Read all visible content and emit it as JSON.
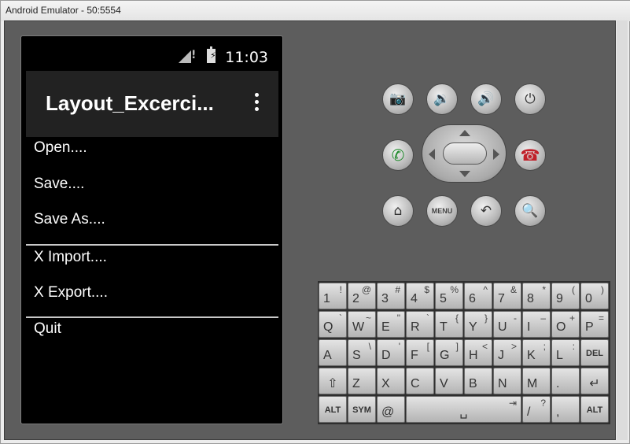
{
  "window": {
    "title": "Android Emulator - 50:5554"
  },
  "status_bar": {
    "time": "11:03"
  },
  "action_bar": {
    "title": "Layout_Excerci..."
  },
  "menu": {
    "items": [
      "Open....",
      "Save....",
      "Save As....",
      "X Import....",
      "X Export....",
      "Quit"
    ]
  },
  "controls": {
    "row1": [
      "camera-icon",
      "volume-down-icon",
      "volume-up-icon",
      "power-icon"
    ],
    "call": "call-icon",
    "end_call": "end-call-icon",
    "row3": [
      "home-icon",
      "menu-button",
      "back-icon",
      "search-icon"
    ],
    "menu_label": "MENU"
  },
  "keyboard": {
    "row1": [
      [
        "1",
        "!"
      ],
      [
        "2",
        "@"
      ],
      [
        "3",
        "#"
      ],
      [
        "4",
        "$"
      ],
      [
        "5",
        "%"
      ],
      [
        "6",
        "^"
      ],
      [
        "7",
        "&"
      ],
      [
        "8",
        "*"
      ],
      [
        "9",
        "("
      ],
      [
        "0",
        ")"
      ]
    ],
    "row2": [
      [
        "Q",
        "`"
      ],
      [
        "W",
        "~"
      ],
      [
        "E",
        "\""
      ],
      [
        "R",
        "`"
      ],
      [
        "T",
        "{"
      ],
      [
        "Y",
        "}"
      ],
      [
        "U",
        "-"
      ],
      [
        "I",
        "–"
      ],
      [
        "O",
        "+"
      ],
      [
        "P",
        "="
      ]
    ],
    "row3": [
      [
        "A",
        ""
      ],
      [
        "S",
        "\\"
      ],
      [
        "D",
        "'"
      ],
      [
        "F",
        "["
      ],
      [
        "G",
        "]"
      ],
      [
        "H",
        "<"
      ],
      [
        "J",
        ">"
      ],
      [
        "K",
        ";"
      ],
      [
        "L",
        ":"
      ],
      [
        "DEL",
        ""
      ]
    ],
    "row4": [
      [
        "⇧",
        ""
      ],
      [
        "Z",
        ""
      ],
      [
        "X",
        ""
      ],
      [
        "C",
        ""
      ],
      [
        "V",
        ""
      ],
      [
        "B",
        ""
      ],
      [
        "N",
        ""
      ],
      [
        "M",
        ""
      ],
      [
        ".",
        ""
      ],
      [
        "↵",
        ""
      ]
    ],
    "row5": [
      [
        "ALT",
        ""
      ],
      [
        "SYM",
        ""
      ],
      [
        "@",
        ""
      ],
      [
        "␣",
        "⇥"
      ],
      [
        "/",
        "?"
      ],
      [
        ",",
        ""
      ],
      [
        "ALT",
        ""
      ]
    ]
  }
}
